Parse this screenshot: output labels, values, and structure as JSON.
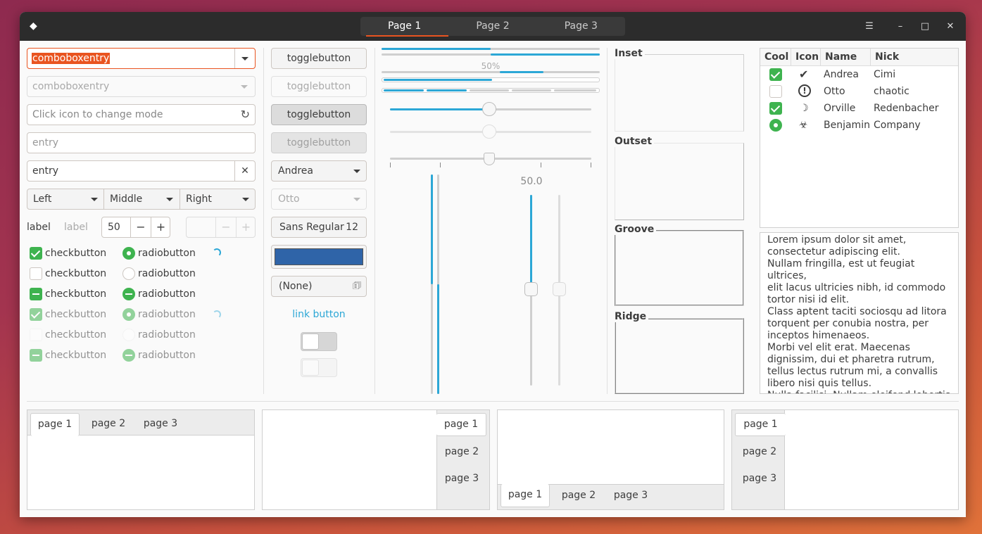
{
  "headerbar": {
    "tabs": [
      "Page 1",
      "Page 2",
      "Page 3"
    ],
    "active": 0,
    "icons": [
      "menu-icon",
      "minimize-icon",
      "maximize-icon",
      "close-icon"
    ]
  },
  "col1": {
    "combo_entry": "comboboxentry",
    "combo_entry_disabled": "comboboxentry",
    "search_placeholder": "Click icon to change mode",
    "entry_placeholder": "entry",
    "entry_value": "entry",
    "linked": [
      "Left",
      "Middle",
      "Right"
    ],
    "label1": "label",
    "label2": "label",
    "spin_value": "50",
    "checks": [
      "checkbutton",
      "checkbutton",
      "checkbutton",
      "checkbutton",
      "checkbutton",
      "checkbutton"
    ],
    "radios": [
      "radiobutton",
      "radiobutton",
      "radiobutton",
      "radiobutton",
      "radiobutton",
      "radiobutton"
    ]
  },
  "col2": {
    "toggles": [
      "togglebutton",
      "togglebutton",
      "togglebutton",
      "togglebutton"
    ],
    "combo1": "Andrea",
    "combo2": "Otto",
    "font_name": "Sans Regular",
    "font_size": "12",
    "color": "#2f64a8",
    "file": "(None)",
    "link": "link button"
  },
  "col3": {
    "progress_label": "50%",
    "scale_value": "50.0",
    "progress": 0.5
  },
  "col4": {
    "frames": [
      "Inset",
      "Outset",
      "Groove",
      "Ridge"
    ]
  },
  "tree": {
    "headers": [
      "Cool",
      "Icon",
      "Name",
      "Nick"
    ],
    "rows": [
      {
        "cool": "checked",
        "icon": "ok-circle-icon",
        "name": "Andrea",
        "nick": "Cimi"
      },
      {
        "cool": "unchecked",
        "icon": "exclamation-circle-icon",
        "name": "Otto",
        "nick": "chaotic"
      },
      {
        "cool": "checked",
        "icon": "moon-icon",
        "name": "Orville",
        "nick": "Redenbacher"
      },
      {
        "cool": "radio",
        "icon": "spy-icon",
        "name": "Benjamin",
        "nick": "Company"
      }
    ]
  },
  "textview": [
    "Lorem ipsum dolor sit amet,",
    "consectetur adipiscing elit.",
    "Nullam fringilla, est ut feugiat ultrices,",
    "elit lacus ultricies nibh, id commodo",
    "tortor nisi id elit.",
    "Class aptent taciti sociosqu ad litora",
    "torquent per conubia nostra, per",
    "inceptos himenaeos.",
    "Morbi vel elit erat. Maecenas",
    "dignissim, dui et pharetra rutrum,",
    "tellus lectus rutrum mi, a convallis",
    "libero nisi quis tellus.",
    "Nulla facilisi. Nullam eleifend lobortis"
  ],
  "notebooks": [
    {
      "tabs": [
        "page 1",
        "page 2",
        "page 3"
      ]
    },
    {
      "tabs": [
        "page 1",
        "page 2",
        "page 3"
      ]
    },
    {
      "tabs": [
        "page 1",
        "page 2",
        "page 3"
      ]
    },
    {
      "tabs": [
        "page 1",
        "page 2",
        "page 3"
      ]
    }
  ]
}
